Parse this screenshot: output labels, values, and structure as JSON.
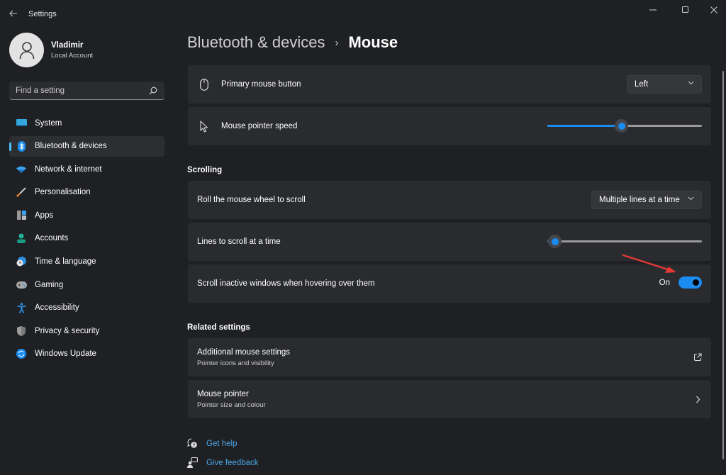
{
  "window": {
    "app_title": "Settings",
    "controls": {
      "minimize": "minimize-icon",
      "maximize": "maximize-icon",
      "close": "close-icon"
    }
  },
  "profile": {
    "name": "Vladimir",
    "account_type": "Local Account"
  },
  "search": {
    "placeholder": "Find a setting",
    "value": ""
  },
  "sidebar": {
    "items": [
      {
        "label": "System",
        "icon": "system-icon",
        "active": false
      },
      {
        "label": "Bluetooth & devices",
        "icon": "bluetooth-icon",
        "active": true
      },
      {
        "label": "Network & internet",
        "icon": "wifi-icon",
        "active": false
      },
      {
        "label": "Personalisation",
        "icon": "brush-icon",
        "active": false
      },
      {
        "label": "Apps",
        "icon": "apps-icon",
        "active": false
      },
      {
        "label": "Accounts",
        "icon": "accounts-icon",
        "active": false
      },
      {
        "label": "Time & language",
        "icon": "time-language-icon",
        "active": false
      },
      {
        "label": "Gaming",
        "icon": "gamepad-icon",
        "active": false
      },
      {
        "label": "Accessibility",
        "icon": "accessibility-icon",
        "active": false
      },
      {
        "label": "Privacy & security",
        "icon": "shield-icon",
        "active": false
      },
      {
        "label": "Windows Update",
        "icon": "update-icon",
        "active": false
      }
    ]
  },
  "breadcrumb": {
    "parent": "Bluetooth & devices",
    "separator": "›",
    "current": "Mouse"
  },
  "settings": {
    "primary_button": {
      "label": "Primary mouse button",
      "value": "Left"
    },
    "pointer_speed": {
      "label": "Mouse pointer speed",
      "value_fraction": 0.48
    },
    "scrolling_title": "Scrolling",
    "roll_wheel": {
      "label": "Roll the mouse wheel to scroll",
      "value": "Multiple lines at a time"
    },
    "lines_to_scroll": {
      "label": "Lines to scroll at a time",
      "value_fraction": 0.05
    },
    "scroll_inactive": {
      "label": "Scroll inactive windows when hovering over them",
      "state_label": "On",
      "on": true
    }
  },
  "related": {
    "title": "Related settings",
    "items": [
      {
        "title": "Additional mouse settings",
        "subtitle": "Pointer icons and visibility",
        "action_icon": "open-external-icon"
      },
      {
        "title": "Mouse pointer",
        "subtitle": "Pointer size and colour",
        "action_icon": "chevron-right-icon"
      }
    ]
  },
  "footer_links": [
    {
      "label": "Get help",
      "icon": "help-icon"
    },
    {
      "label": "Give feedback",
      "icon": "feedback-icon"
    }
  ],
  "colors": {
    "accent": "#1a8cf0",
    "link": "#4aa7e8",
    "annotation_arrow": "#e53935",
    "background": "#1f2023",
    "card": "#2a2b2e"
  }
}
